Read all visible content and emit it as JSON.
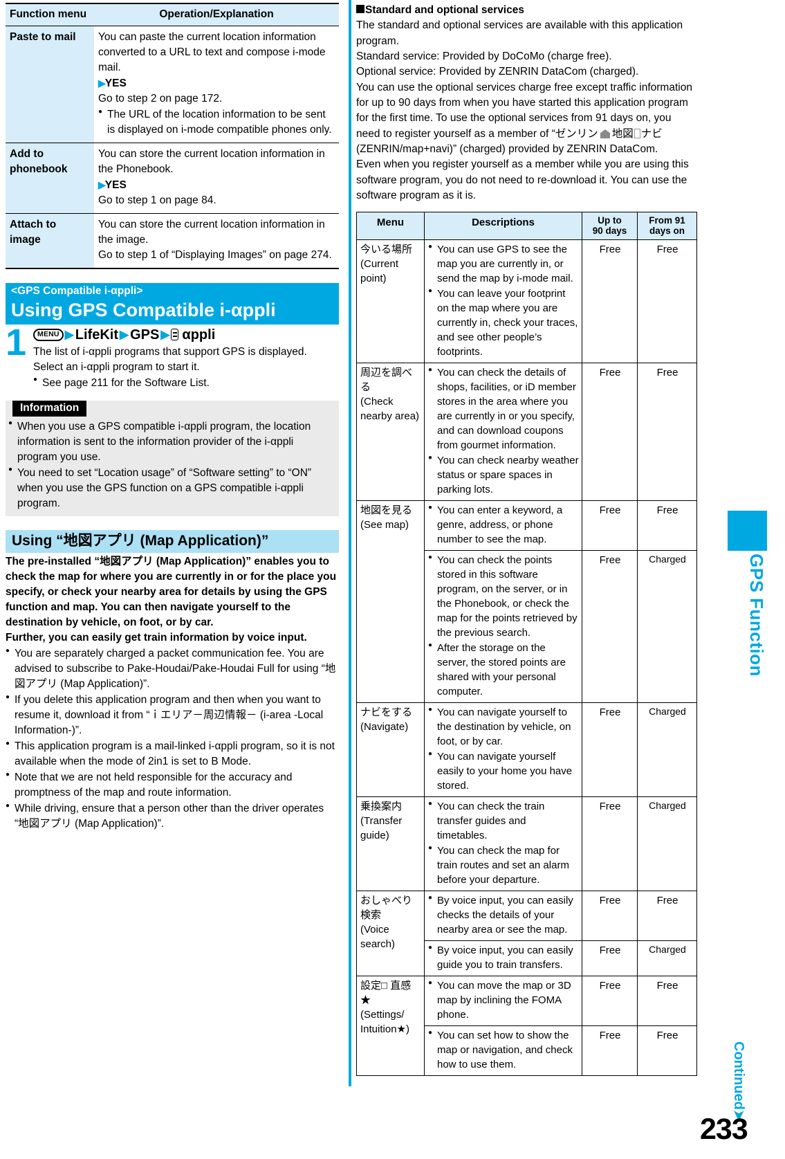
{
  "function_menu_table": {
    "headers": [
      "Function menu",
      "Operation/Explanation"
    ],
    "rows": [
      {
        "menu": "Paste to mail",
        "lines": [
          "You can paste the current location information converted to a URL to text and compose i-mode mail."
        ],
        "yes": "YES",
        "after": "Go to step 2 on page 172.",
        "bullets": [
          "The URL of the location information to be sent is displayed on i-mode compatible phones only."
        ]
      },
      {
        "menu": "Add to phonebook",
        "lines": [
          "You can store the current location information in the Phonebook."
        ],
        "yes": "YES",
        "after": "Go to step 1 on page 84.",
        "bullets": []
      },
      {
        "menu": "Attach to image",
        "lines": [
          "You can store the current location information in the image.",
          "Go to step 1 of “Displaying Images” on page 274."
        ],
        "yes": "",
        "after": "",
        "bullets": []
      }
    ]
  },
  "gps_appli_section": {
    "kicker": "<GPS Compatible i-αppli>",
    "title": "Using GPS Compatible i-αppli",
    "step_number": "1",
    "key_menu": "MENU",
    "op_lifekit": "LifeKit",
    "op_gps": "GPS",
    "op_appli": "αppli",
    "body_line1": "The list of i-αppli programs that support GPS is displayed.",
    "body_line2": "Select an i-αppli program to start it.",
    "body_bullet": "See page 211 for the Software List."
  },
  "information_box": {
    "label": "Information",
    "bullets": [
      "When you use a GPS compatible i-αppli program, the location information is sent to the information provider of the i-αppli program you use.",
      "You need to set “Location usage” of “Software setting” to “ON” when you use the GPS function on a GPS compatible i-αppli program."
    ]
  },
  "map_app_section": {
    "heading": "Using “地図アプリ (Map Application)”",
    "lead": "The pre-installed “地図アプリ (Map Application)” enables you to check the map for where you are currently in or for the place you specify, or check your nearby area for details by using the GPS function and map. You can then navigate yourself to the destination by vehicle, on foot, or by car.\nFurther, you can easily get train information by voice input.",
    "bullets": [
      "You are separately charged a packet communication fee. You are advised to subscribe to Pake-Houdai/Pake-Houdai Full for using “地図アプリ (Map Application)”.",
      "If you delete this application program and then when you want to resume it, download it from “ｉエリア－周辺情報－ (i-area -Local Information-)”.",
      "This application program is a mail-linked i-αppli program, so it is not available when the mode of 2in1 is set to B Mode.",
      "Note that we are not held responsible for the accuracy and promptness of the map and route information.",
      "While driving, ensure that a person other than the driver operates “地図アプリ (Map Application)”."
    ]
  },
  "standard_services": {
    "heading": "Standard and optional services",
    "paragraph_1": "The standard and optional services are available with this application program.",
    "paragraph_2": "Standard service: Provided by DoCoMo (charge free).",
    "paragraph_3": "Optional service: Provided by ZENRIN DataCom (charged).",
    "paragraph_4a": "You can use the optional services charge free except traffic information for up to 90 days from when you have started this application program for the first time. To use the optional services from 91 days on, you need to register yourself as a member of “ゼンリン",
    "paragraph_4b": "地図",
    "paragraph_4c": "ナビ (ZENRIN/map+navi)” (charged) provided by ZENRIN DataCom.",
    "paragraph_5": "Even when you register yourself as a member while you are using this software program, you do not need to re-download it. You can use the software program as it is."
  },
  "services_table": {
    "headers": {
      "menu": "Menu",
      "descriptions": "Descriptions",
      "up_to": "Up to\n90 days",
      "up_to_l1": "Up to",
      "up_to_l2": "90 days",
      "from_l1": "From 91",
      "from_l2": "days on"
    },
    "rows": [
      {
        "menu_jp": "今いる場所",
        "menu_en": "(Current point)",
        "menu_lines": [
          "今いる場所",
          "(Current",
          "point)"
        ],
        "subrows": [
          {
            "bullets": [
              "You can use GPS to see the map you are currently in, or send the map by i-mode mail.",
              "You can leave your footprint on the map where you are currently in, check your traces, and see other people’s footprints."
            ],
            "up_to": "Free",
            "from_91": "Free"
          }
        ]
      },
      {
        "menu_lines": [
          "周辺を調べる",
          "(Check",
          "nearby area)"
        ],
        "subrows": [
          {
            "bullets": [
              "You can check the details of shops, facilities, or iD member stores in the area where you are currently in or you specify, and can download coupons from gourmet information.",
              "You can check nearby weather status or spare spaces in parking lots."
            ],
            "up_to": "Free",
            "from_91": "Free"
          }
        ]
      },
      {
        "menu_lines": [
          "地図を見る",
          "(See map)"
        ],
        "subrows": [
          {
            "bullets": [
              "You can enter a keyword, a genre, address, or phone number to see the map."
            ],
            "up_to": "Free",
            "from_91": "Free"
          },
          {
            "bullets": [
              "You can check the points stored in this software program, on the server, or in the Phonebook, or check the map for the points retrieved by the previous search.",
              "After the storage on the server, the stored points are shared with your personal computer."
            ],
            "up_to": "Free",
            "from_91": "Charged"
          }
        ]
      },
      {
        "menu_lines": [
          "ナビをする",
          "(Navigate)"
        ],
        "subrows": [
          {
            "bullets": [
              "You can navigate yourself to the destination by vehicle, on foot, or by car.",
              "You can navigate yourself easily to your home you have stored."
            ],
            "up_to": "Free",
            "from_91": "Charged"
          }
        ]
      },
      {
        "menu_lines": [
          "乗換案内",
          "(Transfer",
          "guide)"
        ],
        "subrows": [
          {
            "bullets": [
              "You can check the train transfer guides and timetables.",
              "You can check the map for train routes and set an alarm before your departure."
            ],
            "up_to": "Free",
            "from_91": "Charged"
          }
        ]
      },
      {
        "menu_lines": [
          "おしゃべり",
          "検索",
          "(Voice",
          "search)"
        ],
        "subrows": [
          {
            "bullets": [
              "By voice input, you can easily checks the details of your nearby area or see the map."
            ],
            "up_to": "Free",
            "from_91": "Free"
          },
          {
            "bullets": [
              "By voice input, you can easily guide you to train transfers."
            ],
            "up_to": "Free",
            "from_91": "Charged"
          }
        ]
      },
      {
        "menu_lines": [
          "設定□ 直感★",
          "(Settings/",
          "Intuition★)"
        ],
        "subrows": [
          {
            "bullets": [
              "You can move the map or 3D map by inclining the FOMA phone."
            ],
            "up_to": "Free",
            "from_91": "Free"
          },
          {
            "bullets": [
              "You can set how to show the map or navigation, and check how to use them."
            ],
            "up_to": "Free",
            "from_91": "Free"
          }
        ]
      }
    ]
  },
  "side_tab": {
    "label": "GPS Function",
    "continued": "Continued",
    "page_number": "233"
  },
  "colors": {
    "accent_cyan": "#00A8E1",
    "table_header_blue": "#D7EDF9",
    "section_light_blue": "#ACE0F5",
    "info_gray": "#EAEAEA"
  }
}
